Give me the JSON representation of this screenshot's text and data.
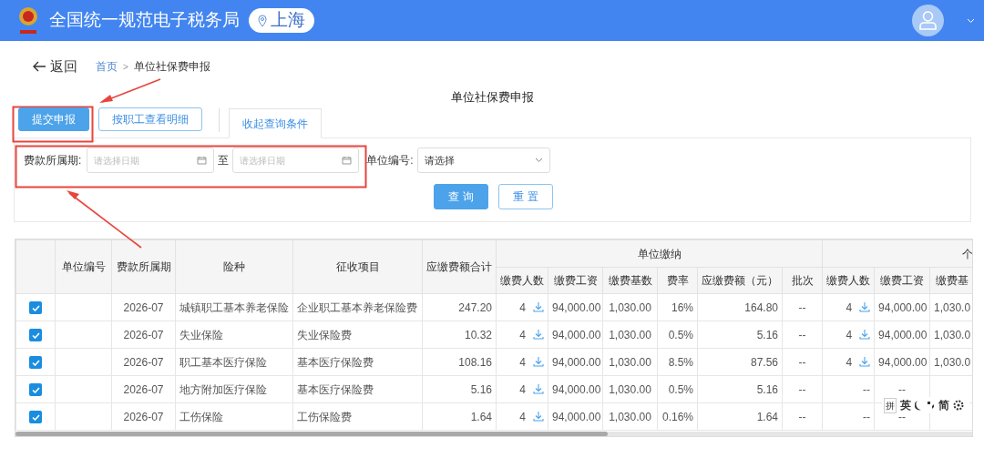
{
  "header": {
    "title": "全国统一规范电子税务局",
    "region": "上海"
  },
  "breadcrumb": {
    "back": "返回",
    "separator": ">",
    "items": [
      {
        "label": "首页",
        "link": true
      },
      {
        "label": "单位社保费申报",
        "link": false
      }
    ]
  },
  "page_title": "单位社保费申报",
  "toolbar": {
    "buttons": [
      {
        "label": "提交申报",
        "kind": "primary"
      },
      {
        "label": "按职工查看明细",
        "kind": "outline"
      }
    ],
    "tab": "收起查询条件"
  },
  "filters": {
    "period_label": "费款所属期:",
    "start": {
      "placeholder": "请选择日期"
    },
    "separator": "至",
    "end": {
      "placeholder": "请选择日期"
    },
    "unit_label": "单位编号:",
    "unit_select": "请选择",
    "buttons": [
      {
        "label": "查 询",
        "kind": "primary"
      },
      {
        "label": "重 置",
        "kind": "outline"
      }
    ]
  },
  "table": {
    "columns": [
      {
        "label": "单位编号"
      },
      {
        "label": "费款所属期"
      },
      {
        "label": "险种"
      },
      {
        "label": "征收项目"
      },
      {
        "label": "应缴费额合计"
      },
      {
        "label": "单位缴纳",
        "colspan": 6,
        "children": [
          "缴费人数",
          "缴费工资",
          "缴费基数",
          "费率",
          "应缴费额（元）",
          "批次"
        ]
      },
      {
        "label": "个",
        "colspan": 3,
        "children": [
          "缴费人数",
          "缴费工资",
          "缴费基"
        ]
      }
    ],
    "rows": [
      {
        "checked": true,
        "cells": [
          "",
          "2026-07",
          "城镇职工基本养老保险",
          "企业职工基本养老保险费",
          "247.20",
          {
            "text": "4",
            "kind": "count"
          },
          "94,000.00",
          "1,030.00",
          "16%",
          "164.80",
          "--",
          {
            "text": "4",
            "kind": "count"
          },
          "94,000.00",
          "1,030.0"
        ]
      },
      {
        "checked": true,
        "cells": [
          "",
          "2026-07",
          "失业保险",
          "失业保险费",
          "10.32",
          {
            "text": "4",
            "kind": "count"
          },
          "94,000.00",
          "1,030.00",
          "0.5%",
          "5.16",
          "--",
          {
            "text": "4",
            "kind": "count"
          },
          "94,000.00",
          "1,030.0"
        ]
      },
      {
        "checked": true,
        "cells": [
          "",
          "2026-07",
          "职工基本医疗保险",
          "基本医疗保险费",
          "108.16",
          {
            "text": "4",
            "kind": "count"
          },
          "94,000.00",
          "1,030.00",
          "8.5%",
          "87.56",
          "--",
          {
            "text": "4",
            "kind": "count"
          },
          "94,000.00",
          "1,030.0"
        ]
      },
      {
        "checked": true,
        "cells": [
          "",
          "2026-07",
          "地方附加医疗保险",
          "基本医疗保险费",
          "5.16",
          {
            "text": "4",
            "kind": "count"
          },
          "94,000.00",
          "1,030.00",
          "0.5%",
          "5.16",
          "--",
          "--",
          "--",
          ""
        ]
      },
      {
        "checked": true,
        "cells": [
          "",
          "2026-07",
          "工伤保险",
          "工伤保险费",
          "1.64",
          {
            "text": "4",
            "kind": "count"
          },
          "94,000.00",
          "1,030.00",
          "0.16%",
          "1.64",
          "--",
          "--",
          "--",
          ""
        ]
      }
    ]
  },
  "ime_toolbar": {
    "items": [
      "拼",
      "英",
      "简"
    ]
  }
}
